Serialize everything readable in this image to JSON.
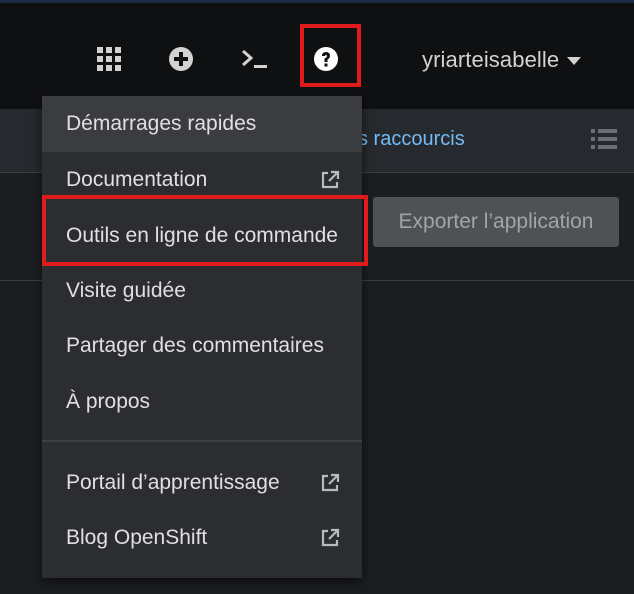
{
  "masthead": {
    "icons": [
      "grid-icon",
      "plus-circle-icon",
      "terminal-icon",
      "help-icon"
    ],
    "username": "yriarteisabelle"
  },
  "toolbar": {
    "shortcuts_link": "s raccourcis",
    "export_button": "Exporter l’application"
  },
  "help_menu": {
    "items": [
      {
        "label": "Démarrages rapides",
        "external": false
      },
      {
        "label": "Documentation",
        "external": true
      },
      {
        "label": "Outils en ligne de commande",
        "external": false
      },
      {
        "label": "Visite guidée",
        "external": false
      },
      {
        "label": "Partager des commentaires",
        "external": false
      },
      {
        "label": "À propos",
        "external": false
      },
      {
        "label": "Portail d’apprentissage",
        "external": true
      },
      {
        "label": "Blog OpenShift",
        "external": true
      }
    ]
  },
  "colors": {
    "highlight": "#e01b1b",
    "link": "#73bcf7",
    "masthead_bg": "#0f1012",
    "menu_bg": "#2b2d31"
  }
}
